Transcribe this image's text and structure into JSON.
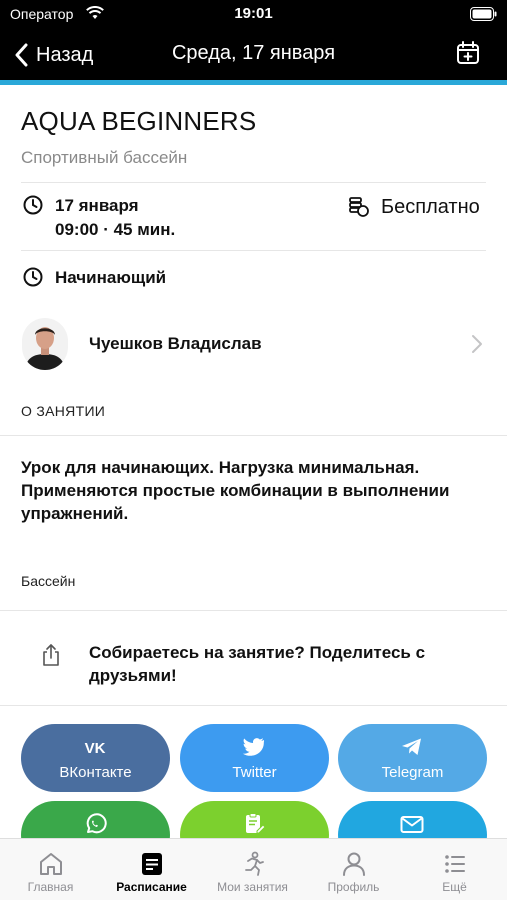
{
  "status_bar": {
    "carrier": "Оператор",
    "time": "19:01"
  },
  "nav": {
    "back_label": "Назад",
    "title": "Среда, 17 января"
  },
  "event": {
    "title": "AQUA BEGINNERS",
    "location": "Спортивный бассейн",
    "date": "17 января",
    "time_duration": "09:00 · 45 мин.",
    "price": "Бесплатно",
    "level": "Начинающий"
  },
  "trainer": {
    "name": "Чуешков Владислав"
  },
  "about": {
    "header": "О ЗАНЯТИИ",
    "description": "Урок для начинающих. Нагрузка минимальная. Применяются простые комбинации в выполнении упражнений.",
    "category": "Бассейн"
  },
  "share": {
    "prompt": "Собираетесь на занятие? Поделитесь с друзьями!",
    "buttons": [
      {
        "label": "ВКонтакте",
        "icon": "vk-icon",
        "color": "#4a6e9f"
      },
      {
        "label": "Twitter",
        "icon": "twitter-icon",
        "color": "#3d9bf0"
      },
      {
        "label": "Telegram",
        "icon": "telegram-icon",
        "color": "#54a9e6"
      },
      {
        "label": "",
        "icon": "whatsapp-icon",
        "color": "#3aa84a"
      },
      {
        "label": "",
        "icon": "notes-icon",
        "color": "#7cd02e"
      },
      {
        "label": "",
        "icon": "mail-icon",
        "color": "#21a7e0"
      }
    ]
  },
  "tabs": [
    {
      "label": "Главная",
      "icon": "home-icon"
    },
    {
      "label": "Расписание",
      "icon": "schedule-icon",
      "active": true
    },
    {
      "label": "Мои занятия",
      "icon": "my-classes-icon"
    },
    {
      "label": "Профиль",
      "icon": "profile-icon"
    },
    {
      "label": "Ещё",
      "icon": "more-icon"
    }
  ],
  "colors": {
    "accent": "#2aa8d8",
    "header_bg": "#000000"
  }
}
